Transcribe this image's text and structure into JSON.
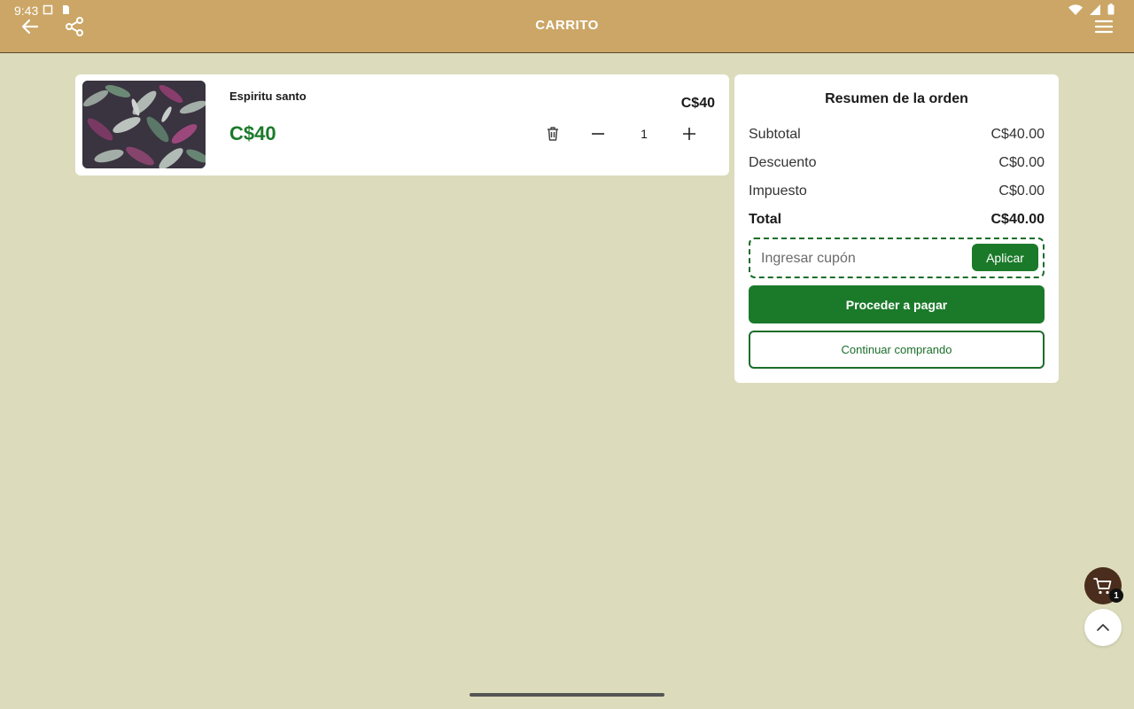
{
  "status_bar": {
    "time": "9:43"
  },
  "header": {
    "title": "CARRITO"
  },
  "icons": {
    "back": "arrow-left-icon",
    "share": "share-icon",
    "menu": "hamburger-menu-icon",
    "trash": "trash-icon",
    "minus": "minus-icon",
    "plus": "plus-icon",
    "cart": "cart-icon",
    "scroll_top": "chevron-up-icon"
  },
  "cart": {
    "items": [
      {
        "name": "Espiritu santo",
        "price": "C$40",
        "line_total": "C$40",
        "quantity": "1"
      }
    ]
  },
  "summary": {
    "title": "Resumen de la orden",
    "rows": [
      {
        "label": "Subtotal",
        "value": "C$40.00"
      },
      {
        "label": "Descuento",
        "value": "C$0.00"
      },
      {
        "label": "Impuesto",
        "value": "C$0.00"
      },
      {
        "label": "Total",
        "value": "C$40.00"
      }
    ],
    "coupon": {
      "placeholder": "Ingresar cupón",
      "value": "",
      "apply_label": "Aplicar"
    },
    "checkout_label": "Proceder a pagar",
    "continue_label": "Continuar comprando"
  },
  "floating": {
    "cart_count": "1"
  },
  "colors": {
    "appbar": "#cba666",
    "background": "#dcdcbc",
    "accent_green": "#1b7a2a",
    "cart_fab": "#4a2d1c"
  }
}
